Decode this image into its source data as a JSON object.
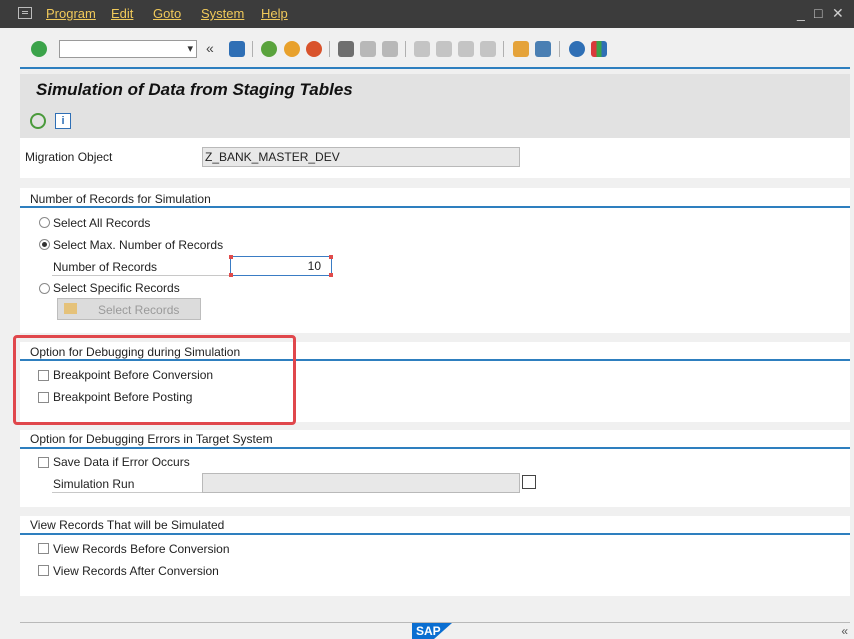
{
  "menu": {
    "items": [
      "Program",
      "Edit",
      "Goto",
      "System",
      "Help"
    ],
    "window_controls": [
      "_",
      "□",
      "✕"
    ]
  },
  "toolbar": {
    "command_field_value": "",
    "icons": [
      "enter-icon",
      "save-icon",
      "back-icon",
      "exit-icon",
      "cancel-icon",
      "print-icon",
      "find-icon",
      "find-next-icon",
      "first-page-icon",
      "previous-page-icon",
      "next-page-icon",
      "last-page-icon",
      "create-session-icon",
      "shortcut-icon",
      "help-icon",
      "customize-layout-icon"
    ]
  },
  "title": "Simulation of Data from Staging Tables",
  "migration": {
    "label": "Migration Object",
    "value": "Z_BANK_MASTER_DEV"
  },
  "records_section": {
    "title": "Number of Records for Simulation",
    "select_all": "Select All Records",
    "select_max": "Select Max. Number of Records",
    "number_label": "Number of Records",
    "number_value": "10",
    "select_specific": "Select Specific Records",
    "select_records_button": "Select Records"
  },
  "debug_section": {
    "title": "Option for Debugging during Simulation",
    "breakpoint_conversion": "Breakpoint Before Conversion",
    "breakpoint_posting": "Breakpoint Before Posting"
  },
  "errors_section": {
    "title": "Option for Debugging Errors in Target System",
    "save_data": "Save Data if Error Occurs",
    "sim_run_label": "Simulation Run",
    "sim_run_value": ""
  },
  "view_section": {
    "title": "View Records That will be Simulated",
    "before": "View Records Before Conversion",
    "after": "View Records After Conversion"
  },
  "footer": {
    "logo": "SAP",
    "chevron": "«"
  },
  "colors": {
    "accent": "#2e7fbf",
    "highlight": "#e0474c",
    "menubar": "#3c3c3c"
  }
}
